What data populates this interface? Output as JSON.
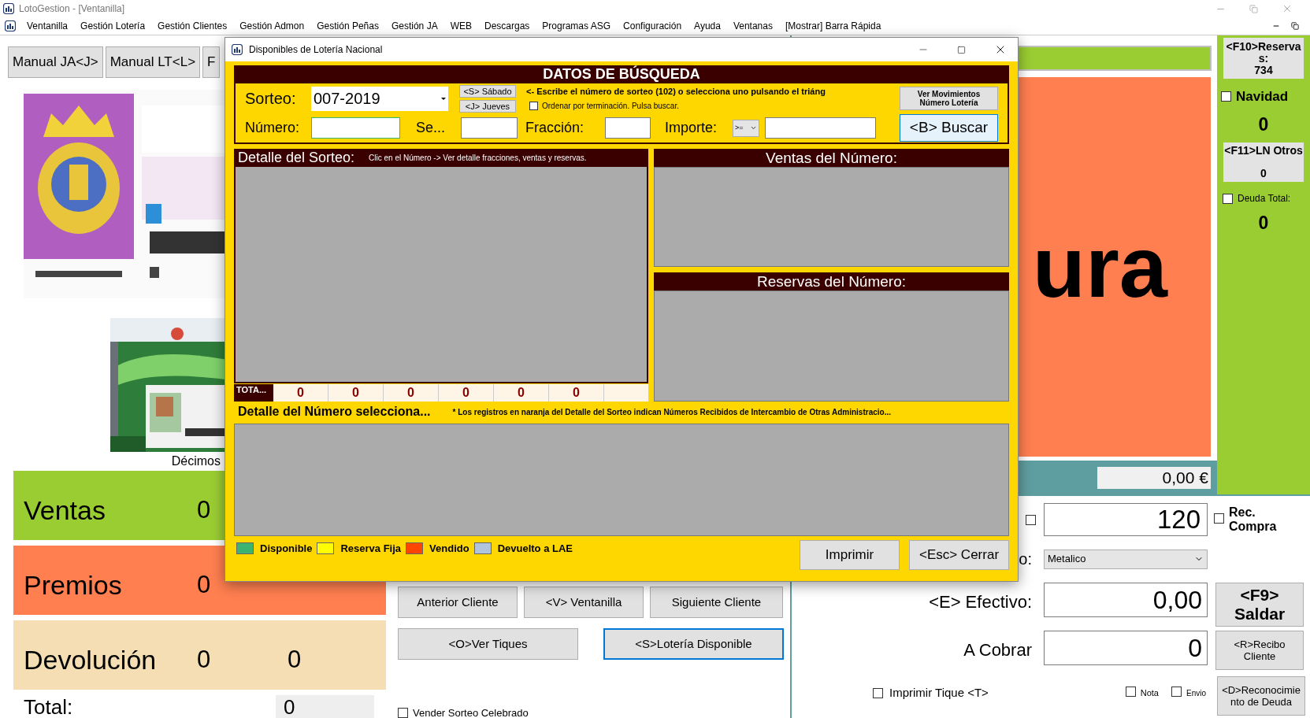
{
  "window": {
    "title": "LotoGestion - [Ventanilla]"
  },
  "menu": [
    "Ventanilla",
    "Gestión Lotería",
    "Gestión Clientes",
    "Gestión Admon",
    "Gestión Peñas",
    "Gestión JA",
    "WEB",
    "Descargas",
    "Programas ASG",
    "Configuración",
    "Ayuda",
    "Ventanas",
    "[Mostrar] Barra Rápida"
  ],
  "tabs": [
    "Manual JA<J>",
    "Manual LT<L>",
    "F"
  ],
  "left_panel": {
    "caption": "Décimos",
    "rows": [
      {
        "label": "Ventas",
        "values": [
          "0"
        ],
        "color": "#9acd32"
      },
      {
        "label": "Premios",
        "values": [
          "0"
        ],
        "color": "#ff7f50"
      },
      {
        "label": "Devolución",
        "values": [
          "0",
          "0"
        ],
        "color": "#f5deb3"
      }
    ],
    "total": {
      "label": "Total:",
      "value": "0"
    }
  },
  "client_buttons": [
    {
      "label": "Anterior Cliente",
      "focused": false
    },
    {
      "label": "<V> Ventanilla",
      "focused": false
    },
    {
      "label": "Siguiente Cliente",
      "focused": false
    }
  ],
  "ticket_buttons": [
    {
      "label": "<O>Ver Tiques",
      "focused": false
    },
    {
      "label": "<S>Lotería Disponible",
      "focused": true
    }
  ],
  "vender_sorteo": {
    "label": "Vender Sorteo Celebrado",
    "checked": false
  },
  "display": {
    "text": "ura",
    "total": "0,00 €"
  },
  "sidebar": {
    "reservas_button": {
      "label": "<F10>Reservas:",
      "value": "734"
    },
    "navidad": {
      "label": "Navidad",
      "checked": false,
      "value": "0"
    },
    "otros_button": {
      "label": "<F11>LN Otros",
      "value": "0"
    },
    "deuda": {
      "label": "Deuda Total:",
      "checked": false,
      "value": "0"
    }
  },
  "payment": {
    "quantity": {
      "checked": false,
      "value": "120"
    },
    "rec_compra": {
      "label": "Rec. Compra",
      "checked": false
    },
    "method": {
      "label": "o:",
      "value": "Metalico"
    },
    "efectivo": {
      "label": "<E> Efectivo:",
      "value": "0,00"
    },
    "cobrar": {
      "label": "A Cobrar",
      "value": "0"
    },
    "imprimir": {
      "label": "Imprimir Tique <T>",
      "checked": false
    },
    "nota": {
      "label": "Nota",
      "checked": false
    },
    "envio": {
      "label": "Envio",
      "checked": false
    },
    "buttons": [
      "<F9> Saldar",
      "<R>Recibo Cliente",
      "<D>Reconocimiento de Deuda"
    ]
  },
  "dialog": {
    "title": "Disponibles de Lotería Nacional",
    "header": "DATOS DE BÚSQUEDA",
    "sorteo": {
      "label": "Sorteo:",
      "value": "007-2019"
    },
    "day_buttons": [
      "<S> Sábado",
      "<J> Jueves"
    ],
    "hint": "<- Escribe el número de sorteo (102) o selecciona uno pulsando el triáng",
    "ordenar": {
      "label": "Ordenar por terminación. Pulsa buscar.",
      "checked": false
    },
    "movimientos_button": "Ver Movimientos Número Lotería",
    "numero": {
      "label": "Número:"
    },
    "serie": {
      "label": "Se..."
    },
    "fraccion": {
      "label": "Fracción:"
    },
    "importe": {
      "label": "Importe:",
      "operator": ">="
    },
    "buscar_button": "<B> Buscar",
    "detalle_sorteo": {
      "title": "Detalle del Sorteo:",
      "hint": "Clic en el Número -> Ver detalle fracciones, ventas y reservas."
    },
    "totals": {
      "label": "TOTA...",
      "values": [
        "0",
        "0",
        "0",
        "0",
        "0",
        "0"
      ]
    },
    "ventas_title": "Ventas del Número:",
    "reservas_title": "Reservas del Número:",
    "detalle_numero": {
      "title": "Detalle del Número selecciona...",
      "note": "* Los registros en naranja del Detalle del Sorteo indican Números Recibidos de Intercambio de Otras Administracio..."
    },
    "legend": [
      {
        "label": "Disponible",
        "color": "#3cb371"
      },
      {
        "label": "Reserva Fija",
        "color": "#ffff00"
      },
      {
        "label": "Vendido",
        "color": "#ff4500"
      },
      {
        "label": "Devuelto a LAE",
        "color": "#b0c4de"
      }
    ],
    "buttons": [
      "Imprimir",
      "<Esc> Cerrar"
    ]
  }
}
